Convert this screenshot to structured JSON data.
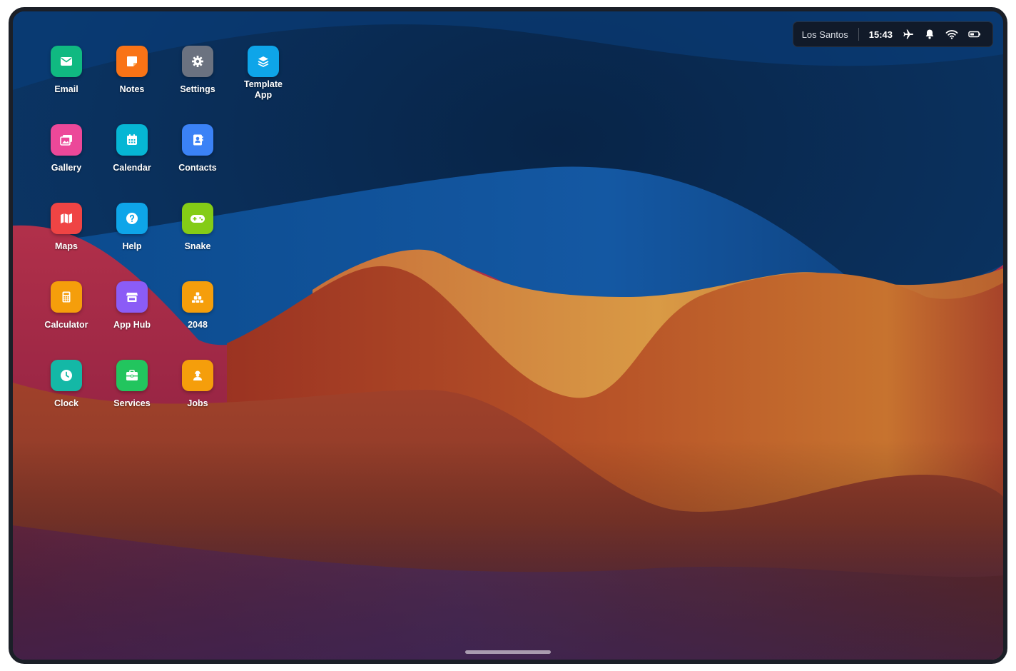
{
  "status_bar": {
    "location": "Los Santos",
    "time": "15:43",
    "icons": [
      "airplane-icon",
      "bell-icon",
      "wifi-icon",
      "battery-icon"
    ]
  },
  "apps": [
    {
      "label": "Email",
      "icon": "mail-icon",
      "color": "#10b981"
    },
    {
      "label": "Notes",
      "icon": "note-icon",
      "color": "#f97316"
    },
    {
      "label": "Settings",
      "icon": "gear-icon",
      "color": "#6b7280"
    },
    {
      "label": "Template\nApp",
      "icon": "layers-icon",
      "color": "#0ea5e9"
    },
    {
      "label": "Gallery",
      "icon": "images-icon",
      "color": "#ec4899"
    },
    {
      "label": "Calendar",
      "icon": "calendar-icon",
      "color": "#06b6d4"
    },
    {
      "label": "Contacts",
      "icon": "contacts-icon",
      "color": "#3b82f6"
    },
    {
      "label": "Maps",
      "icon": "map-icon",
      "color": "#ef4444"
    },
    {
      "label": "Help",
      "icon": "help-icon",
      "color": "#0ea5e9"
    },
    {
      "label": "Snake",
      "icon": "gamepad-icon",
      "color": "#84cc16"
    },
    {
      "label": "Calculator",
      "icon": "calculator-icon",
      "color": "#f59e0b"
    },
    {
      "label": "App Hub",
      "icon": "store-icon",
      "color": "#8b5cf6"
    },
    {
      "label": "2048",
      "icon": "cubes-icon",
      "color": "#f59e0b"
    },
    {
      "label": "Clock",
      "icon": "clock-icon",
      "color": "#14b8a6"
    },
    {
      "label": "Services",
      "icon": "briefcase-icon",
      "color": "#22c55e"
    },
    {
      "label": "Jobs",
      "icon": "worker-icon",
      "color": "#f59e0b"
    }
  ]
}
